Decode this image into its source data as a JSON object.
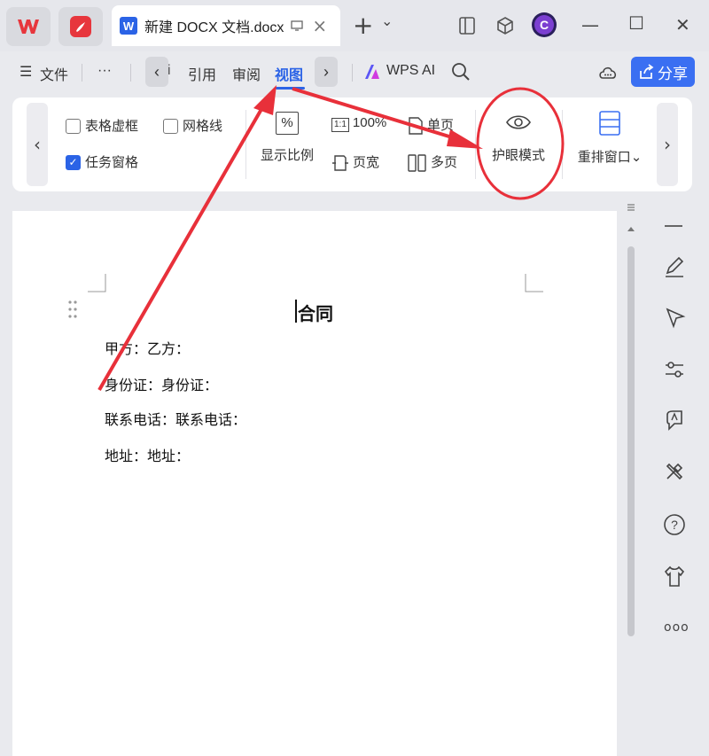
{
  "window": {
    "tab_title": "新建 DOCX 文档.docx",
    "tab_close": "×",
    "new_tab": "+",
    "tab_dropdown": "⌄",
    "minimize": "—",
    "maximize": "☐",
    "close": "✕"
  },
  "menu": {
    "hamburger": "☰",
    "file": "文件",
    "more": "···",
    "prev": "‹",
    "cut_text": "i",
    "reference": "引用",
    "review": "审阅",
    "view": "视图",
    "next": "›",
    "wps_ai": "WPS AI",
    "share": "分享"
  },
  "ribbon": {
    "scroll_left": "‹",
    "scroll_right": "›",
    "table_gridlines": "表格虚框",
    "gridlines": "网格线",
    "task_pane": "任务窗格",
    "zoom": "显示比例",
    "zoom_icon_text": "%",
    "hundred_percent": "100%",
    "hundred_icon_text": "1:1",
    "page_width": "页宽",
    "single_page": "单页",
    "multi_page": "多页",
    "eye_mode": "护眼模式",
    "rearrange": "重排窗口",
    "rearrange_arrow": "⌄"
  },
  "document": {
    "title": "合同",
    "lines": [
      "甲方：乙方：",
      "身份证：身份证：",
      "联系电话：联系电话：",
      "地址：地址："
    ]
  },
  "sidepanel": {
    "icons": [
      "minus-icon",
      "pen-icon",
      "cursor-icon",
      "sliders-icon",
      "ai-icon",
      "tools-icon",
      "help-icon",
      "shirt-icon",
      "more-icon"
    ],
    "more_label": "ooo"
  },
  "annotation": {
    "color": "#e8303a"
  },
  "colors": {
    "accent": "#2b63e6",
    "share_bg": "#3a6ff2",
    "wps_red": "#e7363d"
  }
}
